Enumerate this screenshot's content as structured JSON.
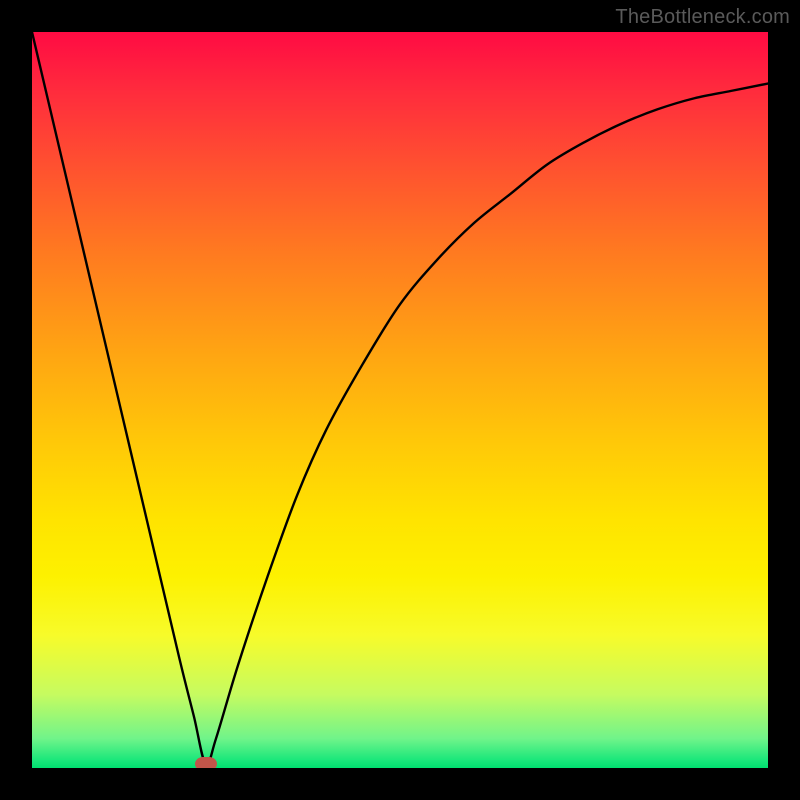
{
  "watermark": "TheBottleneck.com",
  "colors": {
    "frame": "#000000",
    "curve": "#000000",
    "marker": "#c1554a"
  },
  "chart_data": {
    "type": "line",
    "title": "",
    "xlabel": "",
    "ylabel": "",
    "xlim": [
      0,
      100
    ],
    "ylim": [
      0,
      100
    ],
    "grid": false,
    "series": [
      {
        "name": "bottleneck-curve",
        "x": [
          0,
          4,
          8,
          12,
          16,
          20,
          22,
          23.6,
          25,
          28,
          32,
          36,
          40,
          45,
          50,
          55,
          60,
          65,
          70,
          75,
          80,
          85,
          90,
          95,
          100
        ],
        "values": [
          100,
          83,
          66,
          49,
          32,
          15,
          7,
          0.5,
          4,
          14,
          26,
          37,
          46,
          55,
          63,
          69,
          74,
          78,
          82,
          85,
          87.5,
          89.5,
          91,
          92,
          93
        ]
      }
    ],
    "marker": {
      "x": 23.6,
      "y": 0.5
    },
    "background_gradient_stops": [
      {
        "pos": 0,
        "color": "#ff0b43"
      },
      {
        "pos": 50,
        "color": "#ffc400"
      },
      {
        "pos": 100,
        "color": "#00e070"
      }
    ]
  }
}
